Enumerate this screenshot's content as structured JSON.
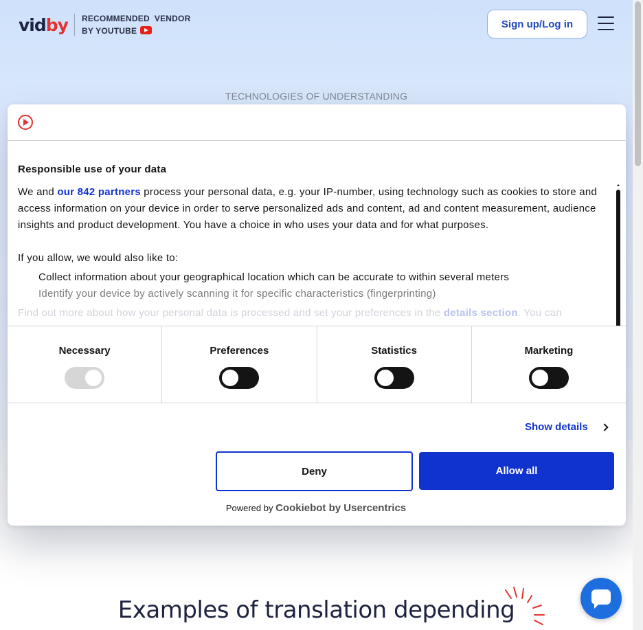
{
  "header": {
    "logo_vid": "vid",
    "logo_by": "by",
    "vendor_line1": "RECOMMENDED  VENDOR",
    "vendor_line2": "BY YOUTUBE",
    "signup_label": "Sign up/Log in",
    "tagline": "TECHNOLOGIES OF UNDERSTANDING"
  },
  "cookie_dialog": {
    "title": "Responsible use of your data",
    "p1_before": "We and ",
    "partners_link": "our 842 partners",
    "p1_after": " process your personal data, e.g. your IP-number, using technology such as cookies to store and access information on your device in order to serve personalized ads and content, ad and content measurement, audience insights and product development. You have a choice in who uses your data and for what purposes.",
    "p2": "If you allow, we would also like to:",
    "list": [
      "Collect information about your geographical location which can be accurate to within several meters",
      "Identify your device by actively scanning it for specific characteristics (fingerprinting)"
    ],
    "p3_before": "Find out more about how your personal data is processed and set your preferences in the ",
    "details_link": "details section",
    "p3_after": ". You can",
    "categories": [
      {
        "label": "Necessary",
        "enabled": true,
        "disabled": true
      },
      {
        "label": "Preferences",
        "enabled": false,
        "disabled": false
      },
      {
        "label": "Statistics",
        "enabled": false,
        "disabled": false
      },
      {
        "label": "Marketing",
        "enabled": false,
        "disabled": false
      }
    ],
    "show_details": "Show details",
    "deny_label": "Deny",
    "allow_label": "Allow all",
    "powered_by": "Powered by ",
    "powered_brand": "Cookiebot by Usercentrics"
  },
  "page": {
    "examples_heading": "Examples of translation depending"
  },
  "colors": {
    "brand_blue": "#1032cf",
    "brand_red": "#e3322f",
    "text_dark": "#1d2340"
  },
  "icons": {
    "menu": "hamburger-icon",
    "youtube": "youtube-icon",
    "cookiebot": "cookiebot-logo-icon",
    "chevron": "chevron-right-icon",
    "chat": "chat-icon"
  }
}
